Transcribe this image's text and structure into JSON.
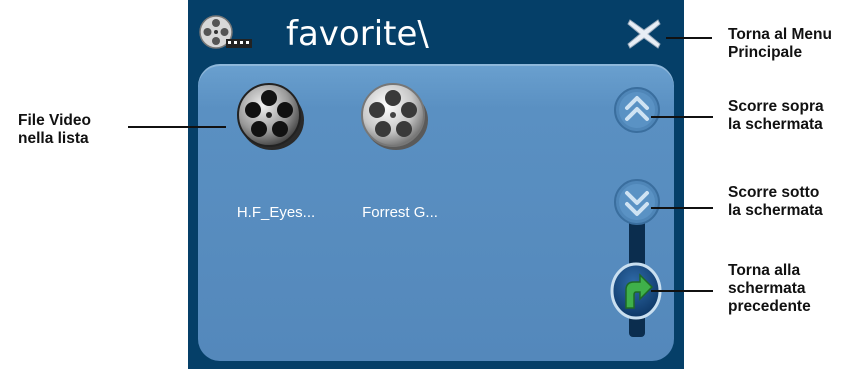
{
  "window": {
    "title": "favorite\\",
    "title_icon": "film-reel-camera-icon",
    "close_icon": "close-x-icon"
  },
  "files": [
    {
      "label": "H.F_Eyes...",
      "icon": "film-reel-dark-icon",
      "selected": true
    },
    {
      "label": "Forrest G...",
      "icon": "film-reel-light-icon",
      "selected": false
    }
  ],
  "controls": {
    "scroll_up_icon": "double-chevron-up-icon",
    "scroll_down_icon": "double-chevron-down-icon",
    "back_icon": "green-return-arrow-icon"
  },
  "callouts": {
    "file_list": "File Video\nnella lista",
    "main_menu": "Torna al Menu\nPrincipale",
    "scroll_up": "Scorre sopra\nla schermata",
    "scroll_down": "Scorre sotto\nla schermata",
    "back": "Torna alla\nschermata\nprecedente"
  },
  "colors": {
    "frame": "#053f68",
    "panel": "#5a90c2",
    "accent_green": "#2f9a3a"
  }
}
